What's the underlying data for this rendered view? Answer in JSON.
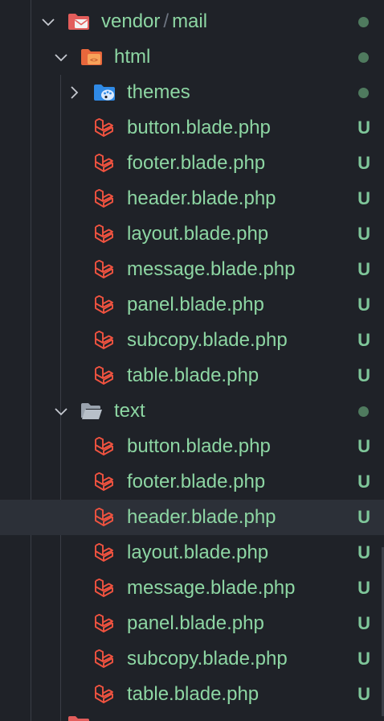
{
  "explorer": {
    "vendor_folder": {
      "label_part1": "vendor",
      "separator": "/",
      "label_part2": "mail",
      "icon": "folder-mail-icon",
      "expanded": true
    },
    "html_folder": {
      "label": "html",
      "icon": "folder-html-icon",
      "expanded": true
    },
    "themes_folder": {
      "label": "themes",
      "icon": "folder-theme-icon",
      "expanded": false
    },
    "html_files": [
      {
        "label": "button.blade.php",
        "status": "U"
      },
      {
        "label": "footer.blade.php",
        "status": "U"
      },
      {
        "label": "header.blade.php",
        "status": "U"
      },
      {
        "label": "layout.blade.php",
        "status": "U"
      },
      {
        "label": "message.blade.php",
        "status": "U"
      },
      {
        "label": "panel.blade.php",
        "status": "U"
      },
      {
        "label": "subcopy.blade.php",
        "status": "U"
      },
      {
        "label": "table.blade.php",
        "status": "U"
      }
    ],
    "text_folder": {
      "label": "text",
      "icon": "folder-open-icon",
      "expanded": true
    },
    "text_files": [
      {
        "label": "button.blade.php",
        "status": "U"
      },
      {
        "label": "footer.blade.php",
        "status": "U"
      },
      {
        "label": "header.blade.php",
        "status": "U",
        "selected": true
      },
      {
        "label": "layout.blade.php",
        "status": "U"
      },
      {
        "label": "message.blade.php",
        "status": "U"
      },
      {
        "label": "panel.blade.php",
        "status": "U"
      },
      {
        "label": "subcopy.blade.php",
        "status": "U"
      },
      {
        "label": "table.blade.php",
        "status": "U"
      }
    ],
    "colors": {
      "background": "#1f2228",
      "selected_row": "#2c3038",
      "label_untracked": "#8dd6a3",
      "status_u": "#7fc79a",
      "status_dot": "#4f7a5e",
      "laravel_icon": "#f05340"
    }
  }
}
